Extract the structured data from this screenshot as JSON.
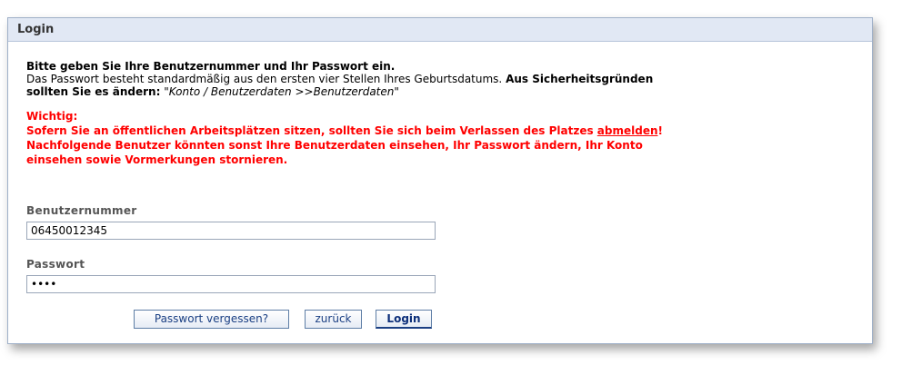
{
  "panel": {
    "title": "Login"
  },
  "intro": {
    "heading": "Bitte geben Sie Ihre Benutzernummer und Ihr Passwort ein.",
    "line1_plain": "Das Passwort besteht standardmäßig aus den ersten vier Stellen Ihres Geburtsdatums.",
    "line1_bold": "Aus Sicherheitsgründen",
    "line2_bold": "sollten Sie es ändern:",
    "line2_italic": "\"Konto / Benutzerdaten >>Benutzerdaten\""
  },
  "warning": {
    "title": "Wichtig:",
    "line1_before": "Sofern Sie an öffentlichen Arbeitsplätzen sitzen, sollten Sie sich beim Verlassen des Platzes",
    "line1_link": "abmelden",
    "line1_after": "!",
    "line2": "Nachfolgende Benutzer könnten sonst Ihre Benutzerdaten einsehen, Ihr Passwort ändern, Ihr Konto",
    "line3": "einsehen sowie Vormerkungen stornieren."
  },
  "form": {
    "user_label": "Benutzernummer",
    "user_value": "06450012345",
    "password_label": "Passwort",
    "password_value": "••••"
  },
  "buttons": {
    "forgot": "Passwort vergessen?",
    "back": "zurück",
    "login": "Login"
  }
}
